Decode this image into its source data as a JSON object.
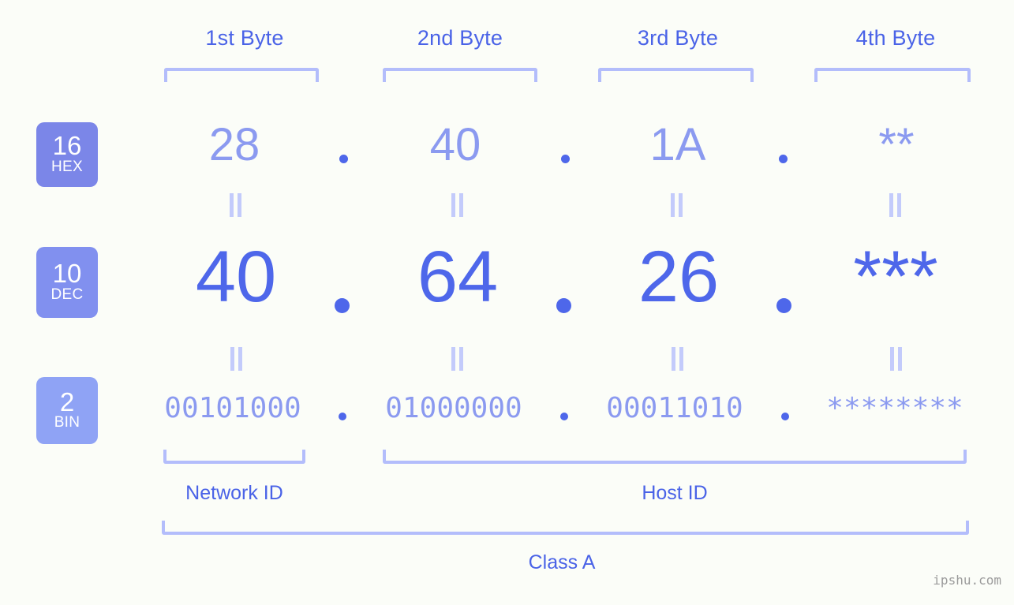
{
  "background_color": "#fbfdf8",
  "accent_color": "#4e67ea",
  "muted_accent_color": "#8b9af0",
  "bracket_color": "#b3bdfb",
  "byte_headers": [
    {
      "label": "1st Byte"
    },
    {
      "label": "2nd Byte"
    },
    {
      "label": "3rd Byte"
    },
    {
      "label": "4th Byte"
    }
  ],
  "rows": [
    {
      "badge_number": "16",
      "badge_name": "HEX",
      "badge_color": "#7b86e8",
      "values": [
        "28",
        "40",
        "1A",
        "**"
      ]
    },
    {
      "badge_number": "10",
      "badge_name": "DEC",
      "badge_color": "#8190ef",
      "values": [
        "40",
        "64",
        "26",
        "***"
      ]
    },
    {
      "badge_number": "2",
      "badge_name": "BIN",
      "badge_color": "#8fa3f5",
      "values": [
        "00101000",
        "01000000",
        "00011010",
        "********"
      ]
    }
  ],
  "separators": {
    "hex": ".",
    "dec": ".",
    "bin": "."
  },
  "equals_symbol": "||",
  "sections": [
    {
      "label": "Network ID"
    },
    {
      "label": "Host ID"
    }
  ],
  "class_label": "Class A",
  "watermark": "ipshu.com"
}
